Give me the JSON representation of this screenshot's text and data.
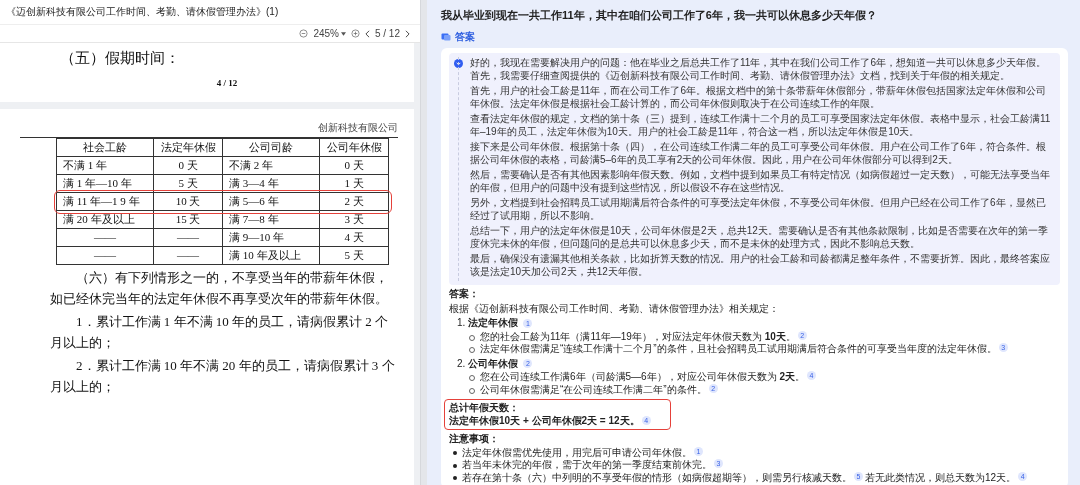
{
  "document": {
    "title": "《迈创新科技有限公司工作时间、考勤、请休假管理办法》(1)",
    "zoom": "245%",
    "page_indicator": "5 / 12",
    "section_heading": "（五）假期时间：",
    "page_number": "4 / 12",
    "header_company": "创新科技有限公司",
    "table": {
      "columns": [
        "社会工龄",
        "法定年休假",
        "公司司龄",
        "公司年休假"
      ],
      "rows": [
        {
          "cells": [
            "不满 1 年",
            "0 天",
            "不满 2 年",
            "0 天"
          ],
          "highlighted": false
        },
        {
          "cells": [
            "满 1 年—10 年",
            "5 天",
            "满 3—4 年",
            "1 天"
          ],
          "highlighted": false
        },
        {
          "cells": [
            "满 11 年—1 9 年",
            "10 天",
            "满 5—6 年",
            "2 天"
          ],
          "highlighted": true
        },
        {
          "cells": [
            "满 20 年及以上",
            "15 天",
            "满 7—8 年",
            "3 天"
          ],
          "highlighted": false
        },
        {
          "cells": [
            "——",
            "——",
            "满 9—10 年",
            "4 天"
          ],
          "highlighted": false
        },
        {
          "cells": [
            "——",
            "——",
            "满 10 年及以上",
            "5 天"
          ],
          "highlighted": false
        }
      ]
    },
    "paragraphs": [
      "（六）有下列情形之一的，不享受当年的带薪年休假，如已经休完当年的法定年休假不再享受次年的带薪年休假。",
      "1．累计工作满 1 年不满 10 年的员工，请病假累计 2 个月以上的；",
      "2．累计工作满 10 年不满 20 年的员工，请病假累计 3 个月以上的；"
    ]
  },
  "chat": {
    "question": "我从毕业到现在一共工作11年，其中在咱们公司工作了6年，我一共可以休息多少天年假？",
    "answer_label": "答案",
    "thinking": [
      "好的，我现在需要解决用户的问题：他在毕业之后总共工作了11年，其中在我们公司工作了6年，想知道一共可以休息多少天年假。首先，我需要仔细查阅提供的《迈创新科技有限公司工作时间、考勤、请休假管理办法》文档，找到关于年假的相关规定。",
      "首先，用户的社会工龄是11年，而在公司工作了6年。根据文档中的第十条带薪年休假部分，带薪年休假包括国家法定年休假和公司年休假。法定年休假是根据社会工龄计算的，而公司年休假则取决于在公司连续工作的年限。",
      "查看法定年休假的规定，文档的第十条（三）提到，连续工作满十二个月的员工可享受国家法定年休假。表格中显示，社会工龄满11年–19年的员工，法定年休假为10天。用户的社会工龄是11年，符合这一档，所以法定年休假是10天。",
      "接下来是公司年休假。根据第十条（四），在公司连续工作满二年的员工可享受公司年休假。用户在公司工作了6年，符合条件。根据公司年休假的表格，司龄满5–6年的员工享有2天的公司年休假。因此，用户在公司年休假部分可以得到2天。",
      "然后，需要确认是否有其他因素影响年假天数。例如，文档中提到如果员工有特定情况（如病假超过一定天数），可能无法享受当年的年假，但用户的问题中没有提到这些情况，所以假设不存在这些情况。",
      "另外，文档提到社会招聘员工试用期满后符合条件的可享受法定年休假，不享受公司年休假。但用户已经在公司工作了6年，显然已经过了试用期，所以不影响。",
      "总结一下，用户的法定年休假是10天，公司年休假是2天，总共12天。需要确认是否有其他条款限制，比如是否需要在次年的第一季度休完未休的年假，但问题问的是总共可以休息多少天，而不是未休的处理方式，因此不影响总天数。",
      "最后，确保没有遗漏其他相关条款，比如折算天数的情况。用户的社会工龄和司龄都满足整年条件，不需要折算。因此，最终答案应该是法定10天加公司2天，共12天年假。"
    ],
    "answer": {
      "heading": "答案：",
      "intro": "根据《迈创新科技有限公司工作时间、考勤、请休假管理办法》相关规定：",
      "sections": [
        {
          "number": "1.",
          "title": "法定年休假",
          "ref": "1",
          "bullets": [
            {
              "segments": [
                {
                  "text": "您的社会工龄为11年（满11年—19年），对应法定年休假天数为 **10天**。",
                  "ref": "2"
                }
              ]
            },
            {
              "segments": [
                {
                  "text": "法定年休假需满足“连续工作满十二个月”的条件，且社会招聘员工试用期满后符合条件的可享受当年度的法定年休假。",
                  "ref": "3"
                }
              ]
            }
          ]
        },
        {
          "number": "2.",
          "title": "公司年休假",
          "ref": "2",
          "bullets": [
            {
              "segments": [
                {
                  "text": "您在公司连续工作满6年（司龄满5—6年），对应公司年休假天数为 **2天**。",
                  "ref": "4"
                }
              ]
            },
            {
              "segments": [
                {
                  "text": "公司年休假需满足“在公司连续工作满二年”的条件。",
                  "ref": "2"
                }
              ]
            }
          ]
        }
      ],
      "total": {
        "title": "总计年假天数：",
        "text": "法定年休假10天 + 公司年休假2天 = 12天。",
        "ref": "4"
      },
      "notes_title": "注意事项：",
      "notes": [
        {
          "segments": [
            {
              "text": "法定年休假需优先使用，用完后可申请公司年休假。",
              "ref": "1"
            }
          ]
        },
        {
          "segments": [
            {
              "text": "若当年未休完的年假，需于次年的第一季度结束前休完。",
              "ref": "3"
            }
          ]
        },
        {
          "segments": [
            {
              "text": "若存在第十条（六）中列明的不享受年假的情形（如病假超期等），则需另行核减天数。",
              "ref": "5"
            },
            {
              "text": "若无此类情况，则总天数为12天。",
              "ref": "4"
            }
          ]
        }
      ]
    }
  }
}
